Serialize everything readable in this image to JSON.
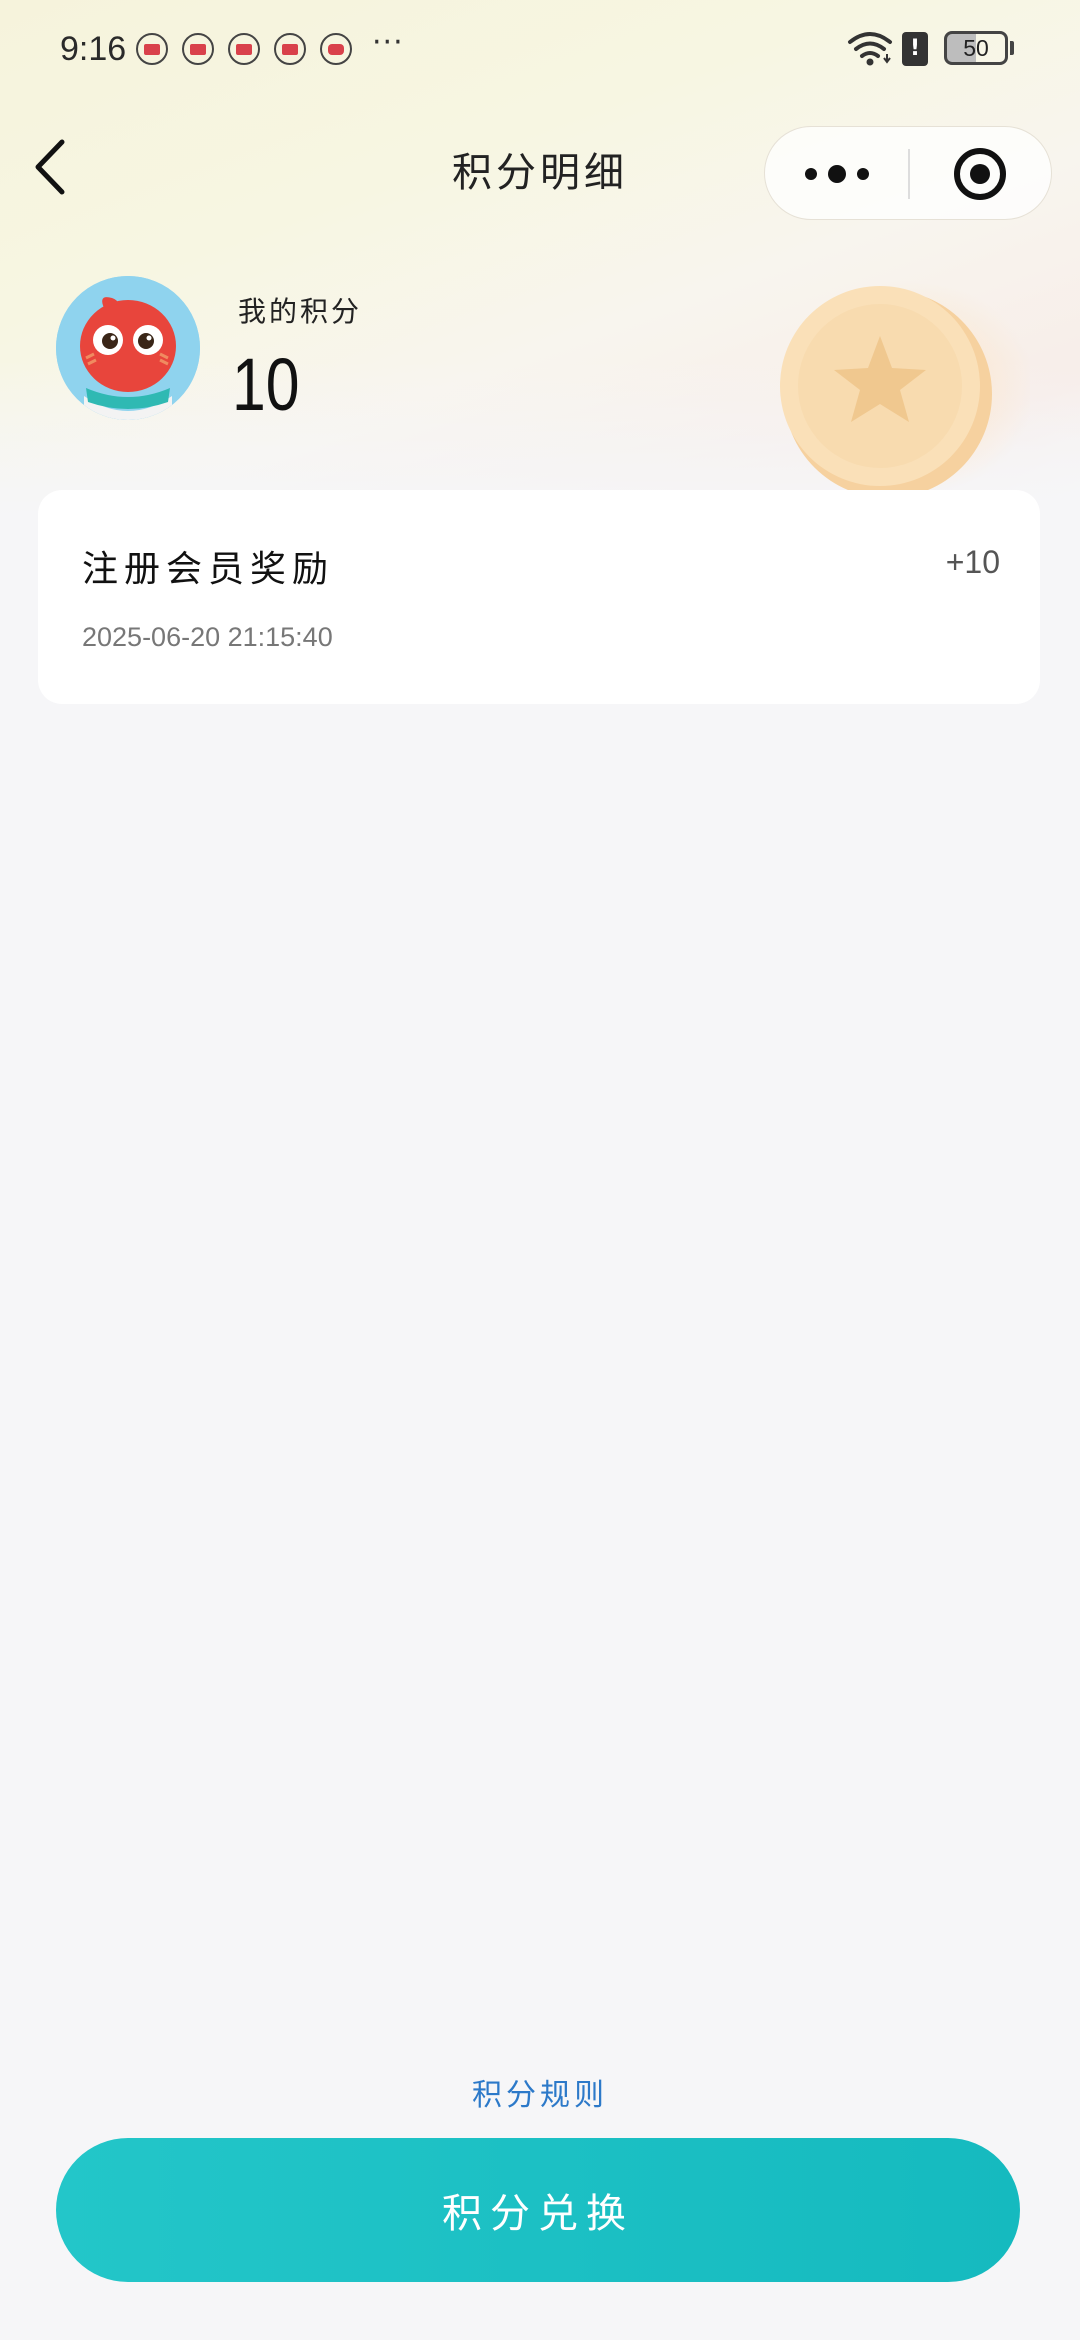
{
  "status_bar": {
    "time": "9:16",
    "more": "···",
    "battery": "50",
    "sim_alert": "!"
  },
  "nav": {
    "title": "积分明细"
  },
  "header": {
    "points_label": "我的积分",
    "points_value": "10"
  },
  "records": [
    {
      "title": "注册会员奖励",
      "amount": "+10",
      "time": "2025-06-20 21:15:40"
    }
  ],
  "footer": {
    "rules_link": "积分规则",
    "exchange_button": "积分兑换"
  },
  "colors": {
    "accent_teal": "#1cc0c4",
    "link_blue": "#2c79c9",
    "notification_red": "#d9414b"
  }
}
